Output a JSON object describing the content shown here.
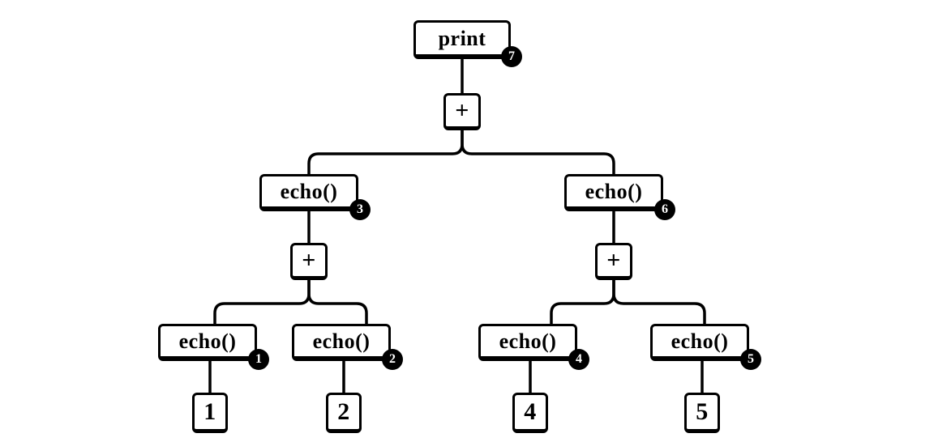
{
  "diagram": {
    "type": "expression-tree",
    "description": "Evaluation-order tree: print(echo(echo(1)+echo(2)) + echo(echo(4)+echo(5))). Badge numbers 1–7 indicate the order in which the echo/print calls execute.",
    "nodes": {
      "root": {
        "label": "print",
        "badge": "7"
      },
      "plus0": {
        "label": "+"
      },
      "echoL": {
        "label": "echo()",
        "badge": "3"
      },
      "echoR": {
        "label": "echo()",
        "badge": "6"
      },
      "plusL": {
        "label": "+"
      },
      "plusR": {
        "label": "+"
      },
      "echo1": {
        "label": "echo()",
        "badge": "1"
      },
      "echo2": {
        "label": "echo()",
        "badge": "2"
      },
      "echo4": {
        "label": "echo()",
        "badge": "4"
      },
      "echo5": {
        "label": "echo()",
        "badge": "5"
      },
      "leaf1": {
        "label": "1"
      },
      "leaf2": {
        "label": "2"
      },
      "leaf4": {
        "label": "4"
      },
      "leaf5": {
        "label": "5"
      }
    }
  }
}
